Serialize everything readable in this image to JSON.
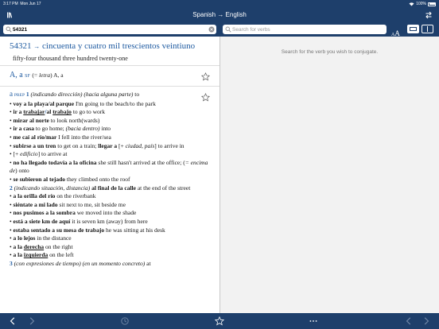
{
  "status": {
    "time": "3:17 PM",
    "date": "Mon Jun 17",
    "battery": "100%"
  },
  "nav": {
    "title": "Spanish → English"
  },
  "search": {
    "query": "54321",
    "verb_placeholder": "Search for verbs"
  },
  "font_toggle": {
    "small": "A",
    "large": "A"
  },
  "right_pane": {
    "hint": "Search for the verb you wish to conjugate."
  },
  "headword": {
    "term": "54321",
    "arrow": "→",
    "spanish": "cincuenta y cuatro mil trescientos veintiuno",
    "english": "fifty-four thousand three hundred twenty-one"
  },
  "entry_letter": {
    "word": "A, a",
    "pos": "SF",
    "note_open": "(=",
    "note_it": "letra",
    "note_close": ")",
    "translation": "A, a"
  },
  "entry_prep": {
    "word": "a",
    "pos": "PREP",
    "lines": [
      "1 (indicando dirección) (hacia alguna parte) to",
      "voy a la playa/al parque I'm going to the beach/to the park",
      "ir a trabajar/al trabajo to go to work",
      "mirar al norte to look north(wards)",
      "ir a casa to go home; (bacia dentro) into",
      "me caí al río/mar I fell into the river/sea",
      "subirse a un tren to get on a train; llegar a [+ ciudad, país] to arrive in",
      "[+ edificio] to arrive at",
      "no ha llegado todavía a la oficina she still hasn't arrived at the office; (= encima de) onto",
      "se subieron al tejado they climbed onto the roof",
      "2 (indicando situación, distancia) al final de la calle at the end of the street",
      "a la orilla del río on the riverbank",
      "siéntate a mi lado sit next to me, sit beside me",
      "nos pusimos a la sombra we moved into the shade",
      "está a siete km de aquí it is seven km (away) from here",
      "estaba sentado a su mesa de trabajo he was sitting at his desk",
      "a lo lejos in the distance",
      "a la derecha on the right",
      "a la izquierda on the left",
      "3 (con expresiones de tiempo) (en un momento concreto) at"
    ]
  },
  "colors": {
    "brand": "#1e3f6b",
    "link": "#1e5aa0"
  },
  "icons": [
    "library-icon",
    "swap-icon",
    "search-icon",
    "clear-icon",
    "star-icon",
    "back-icon",
    "forward-icon",
    "history-icon",
    "favorites-icon",
    "more-icon",
    "prev-icon",
    "next-icon"
  ]
}
